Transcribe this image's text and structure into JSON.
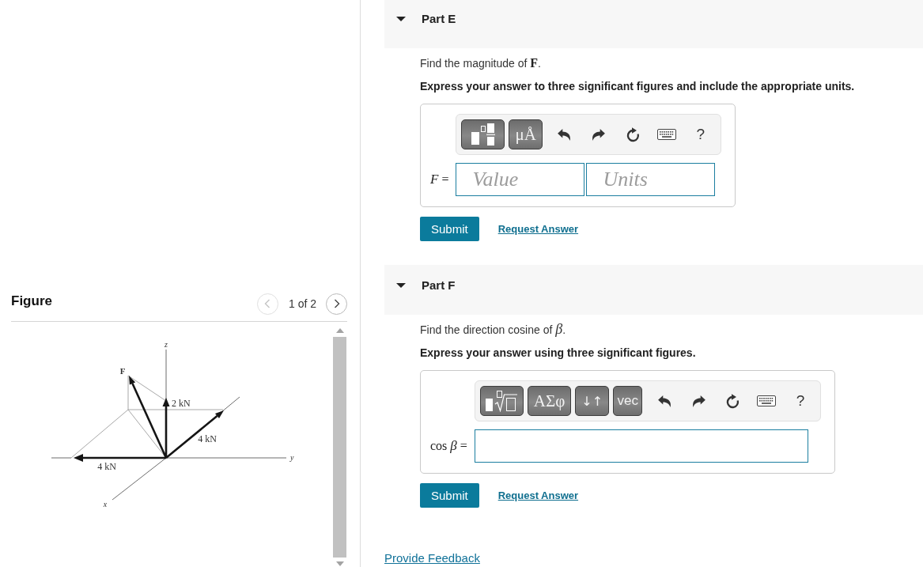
{
  "figure_panel": {
    "title": "Figure",
    "pager": {
      "prev": {
        "disabled": true
      },
      "label": "1 of 2",
      "next": {
        "disabled": false
      }
    },
    "figure": {
      "labels": [
        "z",
        "F",
        "2 kN",
        "4 kN",
        "4 kN",
        "y",
        "x"
      ]
    }
  },
  "parts": [
    {
      "title": "Part E",
      "expanded": true,
      "prompt": "Find the magnitude of **F**.",
      "instruction": "Express your answer to three significant figures and include the appropriate units.",
      "toolbar": [
        {
          "kind": "fraction"
        },
        {
          "kind": "units",
          "label": "μÅ"
        },
        {
          "kind": "undo"
        },
        {
          "kind": "redo"
        },
        {
          "kind": "reset"
        },
        {
          "kind": "keyboard"
        },
        {
          "kind": "help",
          "label": "?"
        }
      ],
      "answer_label": "*F* =",
      "fields": [
        {
          "kind": "value",
          "placeholder": "Value"
        },
        {
          "kind": "units",
          "placeholder": "Units"
        }
      ],
      "actions": [
        {
          "kind": "submit",
          "label": "Submit"
        },
        {
          "kind": "link",
          "label": "Request Answer"
        }
      ]
    },
    {
      "title": "Part F",
      "expanded": true,
      "prompt": "Find the direction cosine of *β*.",
      "instruction": "Express your answer using three significant figures.",
      "toolbar": [
        {
          "kind": "radical"
        },
        {
          "kind": "greek",
          "label": "ΑΣφ"
        },
        {
          "kind": "arrows",
          "label": "↓↑"
        },
        {
          "kind": "vector",
          "label": "vec"
        },
        {
          "kind": "undo"
        },
        {
          "kind": "redo"
        },
        {
          "kind": "reset"
        },
        {
          "kind": "keyboard"
        },
        {
          "kind": "help",
          "label": "?"
        }
      ],
      "answer_label": "cos *β* =",
      "fields": [
        {
          "kind": "expression"
        }
      ],
      "actions": [
        {
          "kind": "submit",
          "label": "Submit"
        },
        {
          "kind": "link",
          "label": "Request Answer"
        }
      ]
    }
  ],
  "footer": {
    "feedback_link": "Provide Feedback"
  }
}
